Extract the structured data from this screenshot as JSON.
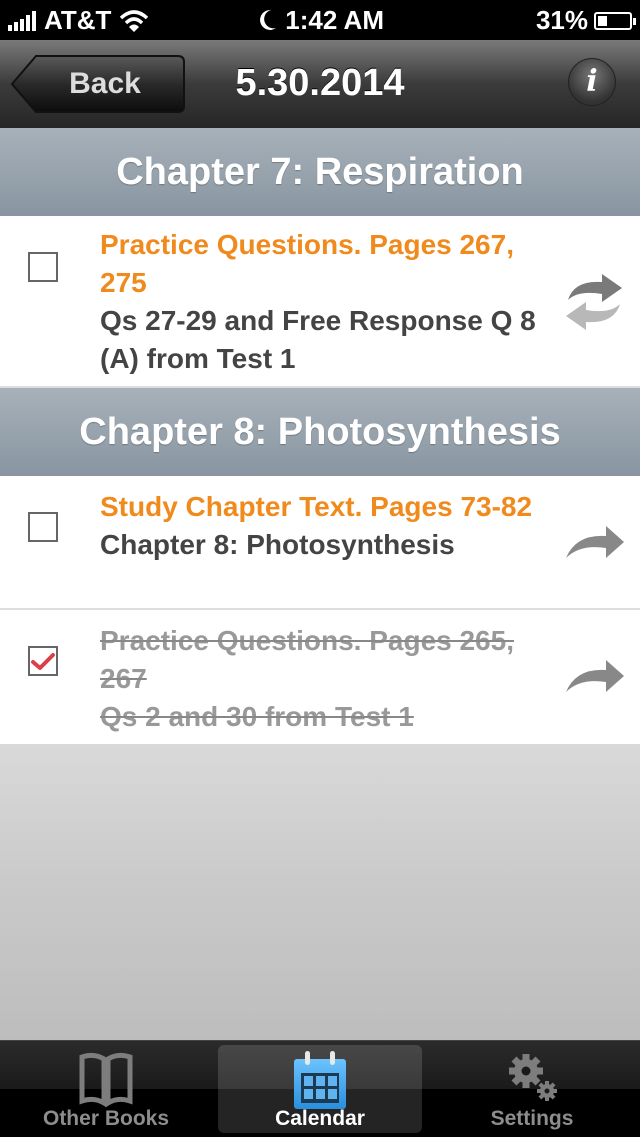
{
  "status_bar": {
    "carrier": "AT&T",
    "time": "1:42 AM",
    "battery_percent_label": "31%",
    "battery_level": 0.31,
    "icons": [
      "signal-icon",
      "wifi-icon",
      "moon-icon",
      "battery-icon"
    ]
  },
  "nav_bar": {
    "back_label": "Back",
    "title": "5.30.2014",
    "info_glyph": "i"
  },
  "sections": [
    {
      "header": "Chapter 7: Respiration",
      "tasks": [
        {
          "title": "Practice Questions. Pages 267, 275",
          "subtitle": "Qs 27-29 and Free Response Q 8 (A) from Test 1",
          "checked": false,
          "action_icon": "repeat-icon"
        }
      ]
    },
    {
      "header": "Chapter 8: Photosynthesis",
      "tasks": [
        {
          "title": "Study Chapter Text. Pages 73-82",
          "subtitle": "Chapter 8: Photosynthesis",
          "checked": false,
          "action_icon": "forward-arrow-icon"
        },
        {
          "title": "Practice Questions. Pages 265, 267",
          "subtitle": "Qs 2 and 30 from Test 1",
          "checked": true,
          "action_icon": "forward-arrow-icon"
        }
      ]
    }
  ],
  "colors": {
    "task_title": "#f08a1d",
    "task_subtitle": "#444444",
    "completed_text": "#999999",
    "check_mark": "#d9404a",
    "section_header": "#98a3ad",
    "calendar_icon": "#3aa5ec"
  },
  "tab_bar": {
    "tabs": [
      {
        "label": "Other Books",
        "icon": "book-icon",
        "active": false
      },
      {
        "label": "Calendar",
        "icon": "calendar-icon",
        "active": true
      },
      {
        "label": "Settings",
        "icon": "gear-icon",
        "active": false
      }
    ]
  }
}
